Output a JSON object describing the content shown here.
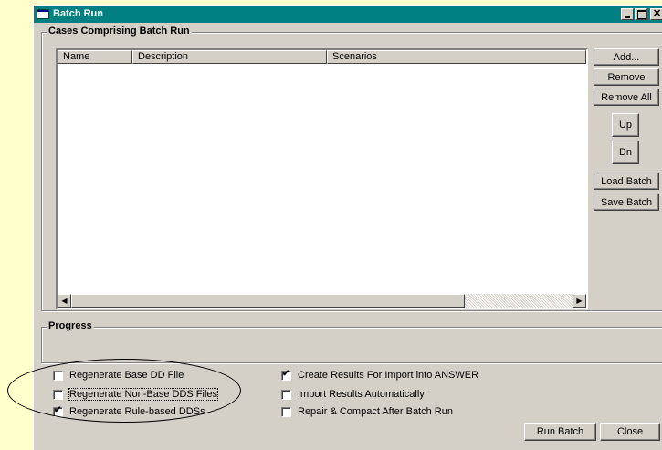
{
  "window": {
    "title": "Batch Run"
  },
  "cases_group": {
    "label": "Cases Comprising Batch Run",
    "columns": [
      "Name",
      "Description",
      "Scenarios"
    ],
    "rows": []
  },
  "side_buttons": {
    "add": "Add...",
    "remove": "Remove",
    "remove_all": "Remove All",
    "up": "Up",
    "dn": "Dn",
    "load_batch": "Load Batch",
    "save_batch": "Save Batch"
  },
  "progress_group": {
    "label": "Progress"
  },
  "options_left": [
    {
      "label": "Regenerate Base DD File",
      "checked": false
    },
    {
      "label": "Regenerate Non-Base DDS Files",
      "checked": false
    },
    {
      "label": "Regenerate Rule-based DDSs",
      "checked": true
    }
  ],
  "options_right": [
    {
      "label": "Create Results For Import into ANSWER",
      "checked": true
    },
    {
      "label": "Import Results Automatically",
      "checked": false
    },
    {
      "label": "Repair & Compact After Batch Run",
      "checked": false
    }
  ],
  "footer_buttons": {
    "run_batch": "Run Batch",
    "close": "Close"
  }
}
